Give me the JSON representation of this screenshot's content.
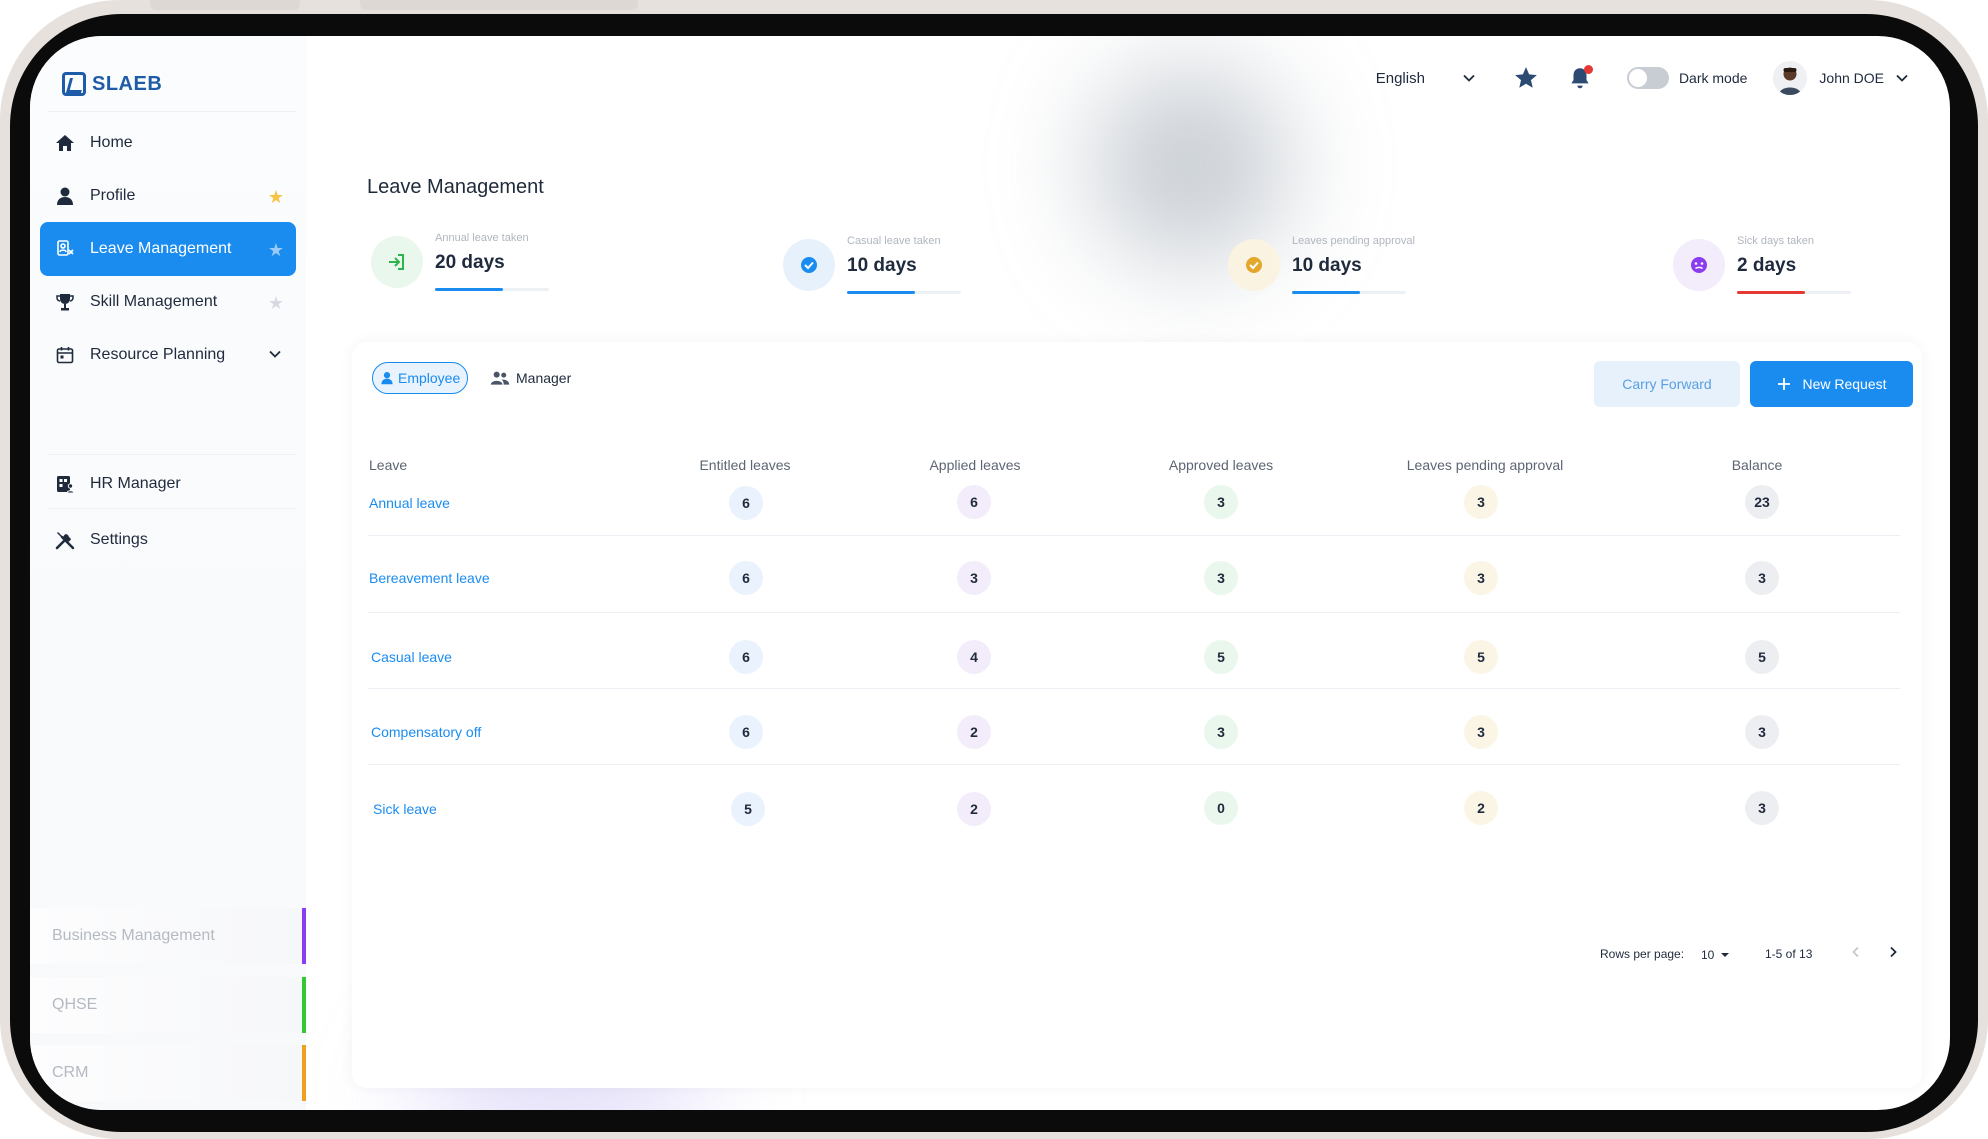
{
  "brand": {
    "name": "SLAEB",
    "color": "#1f5ca8"
  },
  "sidebar": {
    "items": [
      {
        "label": "Home",
        "icon": "home-icon",
        "starred": null
      },
      {
        "label": "Profile",
        "icon": "user-icon",
        "starred": true
      },
      {
        "label": "Leave Management",
        "icon": "leave-icon",
        "starred": false,
        "active": true
      },
      {
        "label": "Skill Management",
        "icon": "trophy-icon",
        "starred": false
      },
      {
        "label": "Resource Planning",
        "icon": "calendar-icon",
        "expandable": true
      },
      {
        "label": "HR Manager",
        "icon": "hr-icon"
      },
      {
        "label": "Settings",
        "icon": "tools-icon"
      }
    ],
    "modules": [
      {
        "label": "Business Management",
        "color": "#8b3cf0"
      },
      {
        "label": "QHSE",
        "color": "#32c832"
      },
      {
        "label": "CRM",
        "color": "#f0a020"
      }
    ]
  },
  "topbar": {
    "language": "English",
    "dark_mode_label": "Dark mode",
    "dark_mode_on": false,
    "user_name": "John DOE",
    "notification_dot_color": "#e53935"
  },
  "page": {
    "title": "Leave Management",
    "stats": [
      {
        "label": "Annual leave taken",
        "value": "20 days",
        "progress": 0.6,
        "color": "#1a8cf0",
        "icon": "enter-icon",
        "icon_bg": "#e9f7ec",
        "icon_color": "#2fb34a"
      },
      {
        "label": "Casual leave taken",
        "value": "10 days",
        "progress": 0.6,
        "color": "#1a8cf0",
        "icon": "check-circle-icon",
        "icon_bg": "#e6f1fc",
        "icon_color": "#1a8cf0"
      },
      {
        "label": "Leaves pending approval",
        "value": "10 days",
        "progress": 0.6,
        "color": "#1a8cf0",
        "icon": "pending-check-icon",
        "icon_bg": "#fbf3e1",
        "icon_color": "#e3a82b"
      },
      {
        "label": "Sick days taken",
        "value": "2 days",
        "progress": 0.6,
        "color": "#e53935",
        "icon": "sick-face-icon",
        "icon_bg": "#f3ecfb",
        "icon_color": "#8b3cf0"
      }
    ]
  },
  "table": {
    "tabs": {
      "employee": "Employee",
      "manager": "Manager"
    },
    "carry_forward_label": "Carry Forward",
    "new_request_label": "New Request",
    "columns": [
      "Leave",
      "Entitled leaves",
      "Applied leaves",
      "Approved leaves",
      "Leaves pending approval",
      "Balance"
    ],
    "rows": [
      {
        "name": "Annual leave",
        "entitled": "6",
        "applied": "6",
        "approved": "3",
        "pending": "3",
        "balance": "23"
      },
      {
        "name": "Bereavement leave",
        "entitled": "6",
        "applied": "3",
        "approved": "3",
        "pending": "3",
        "balance": "3"
      },
      {
        "name": "Casual leave",
        "entitled": "6",
        "applied": "4",
        "approved": "5",
        "pending": "5",
        "balance": "5"
      },
      {
        "name": "Compensatory off",
        "entitled": "6",
        "applied": "2",
        "approved": "3",
        "pending": "3",
        "balance": "3"
      },
      {
        "name": "Sick leave",
        "entitled": "5",
        "applied": "2",
        "approved": "0",
        "pending": "2",
        "balance": "3"
      }
    ],
    "pagination": {
      "rows_per_page_label": "Rows per page:",
      "rows_per_page": "10",
      "range": "1-5 of 13"
    }
  }
}
